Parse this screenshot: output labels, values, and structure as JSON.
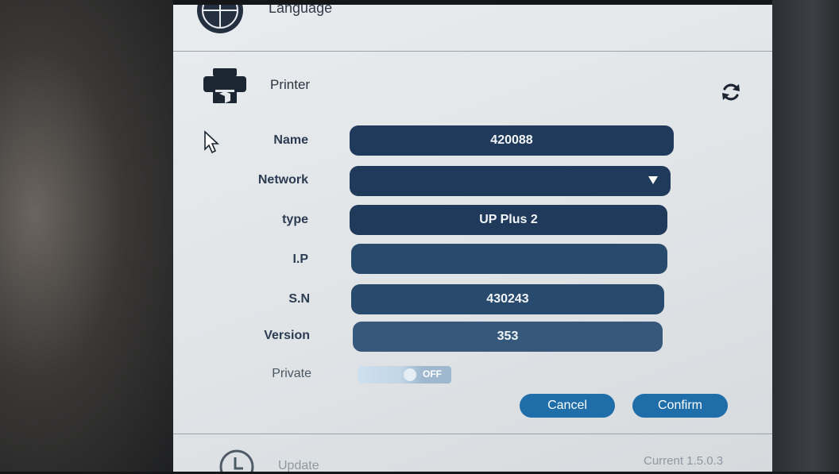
{
  "language": {
    "label": "Language"
  },
  "printer": {
    "title": "Printer",
    "fields": {
      "name": {
        "label": "Name",
        "value": "420088"
      },
      "network": {
        "label": "Network",
        "value": ""
      },
      "type": {
        "label": "type",
        "value": "UP Plus 2"
      },
      "ip": {
        "label": "I.P",
        "value": ""
      },
      "sn": {
        "label": "S.N",
        "value": "430243"
      },
      "version": {
        "label": "Version",
        "value": "353"
      }
    },
    "private": {
      "label": "Private",
      "state": "OFF"
    },
    "buttons": {
      "cancel": "Cancel",
      "confirm": "Confirm"
    }
  },
  "update": {
    "label": "Update",
    "current": "Current 1.5.0.3"
  },
  "colors": {
    "field_bg": "#1f3a5a",
    "button_bg": "#1f6eaa",
    "panel_bg": "#e4e8eb",
    "label_text": "#2c3c52"
  },
  "icons": [
    "globe-icon",
    "printer-icon",
    "refresh-icon",
    "cursor-icon",
    "dropdown-arrow-icon",
    "clock-icon"
  ]
}
